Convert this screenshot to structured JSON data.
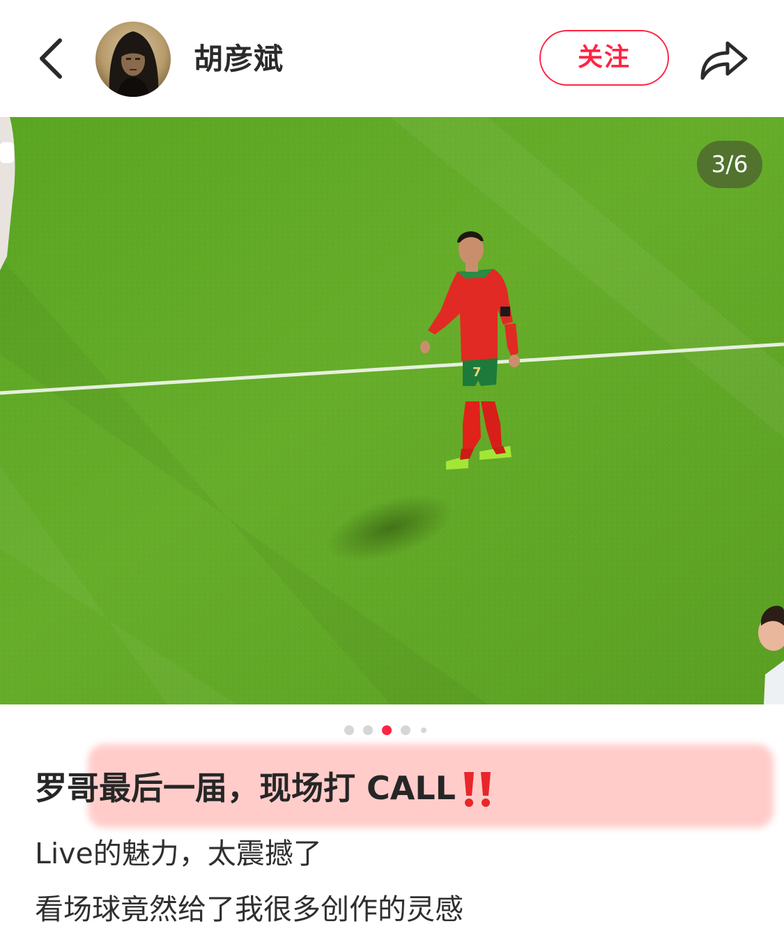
{
  "header": {
    "back_icon": "chevron-left-icon",
    "author_name": "胡彦斌",
    "follow_label": "关注",
    "share_icon": "share-arrow-icon"
  },
  "photo": {
    "counter": "3/6",
    "player_number": "7"
  },
  "carousel": {
    "total_dots_visible": 5,
    "active_index": 2
  },
  "post": {
    "title": "罗哥最后一届，现场打 CALL",
    "title_emoji": "double-exclamation-icon",
    "lines": [
      "Live的魅力，太震撼了",
      "看场球竟然给了我很多创作的灵感"
    ]
  },
  "colors": {
    "accent": "#ff2442",
    "active_dot": "#ff2442",
    "inactive_dot": "#d6d6d6",
    "highlight": "#ffc8c6",
    "pitch": "#5fa725"
  }
}
